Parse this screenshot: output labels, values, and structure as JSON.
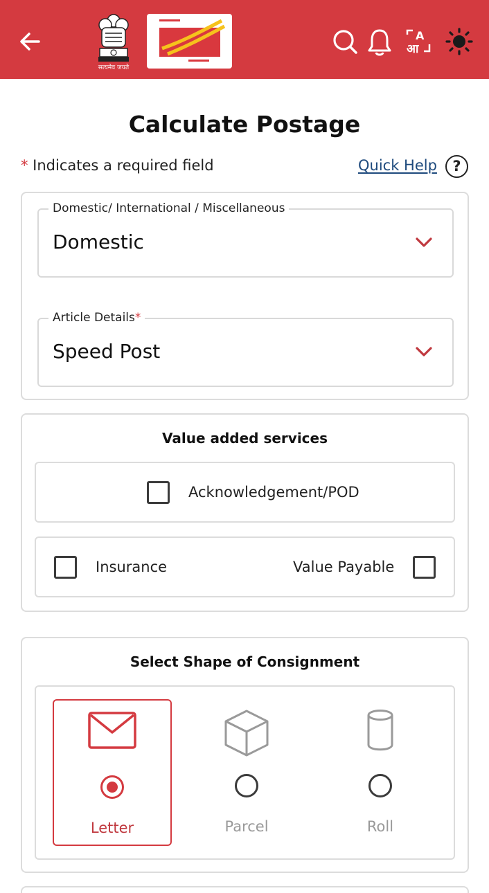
{
  "header": {
    "bg_color": "#d43a40",
    "emblem_motto": "सत्यमेव जयते",
    "icons": [
      "back-arrow-icon",
      "search-icon",
      "bell-icon",
      "translate-icon",
      "brightness-icon"
    ]
  },
  "page": {
    "title": "Calculate Postage",
    "required_note_star": "*",
    "required_note": " Indicates a required field",
    "quick_help": "Quick Help",
    "help_glyph": "?"
  },
  "form": {
    "category": {
      "label": "Domestic/ International / Miscellaneous",
      "value": "Domestic"
    },
    "article": {
      "label": "Article Details",
      "required_star": "*",
      "value": "Speed Post"
    }
  },
  "value_added_services": {
    "title": "Value added services",
    "options": [
      {
        "label": "Acknowledgement/POD",
        "checked": false
      },
      {
        "label": "Insurance",
        "checked": false
      },
      {
        "label": "Value Payable",
        "checked": false
      }
    ]
  },
  "shape": {
    "title": "Select Shape of Consignment",
    "options": [
      {
        "label": "Letter",
        "icon": "envelope-icon",
        "selected": true
      },
      {
        "label": "Parcel",
        "icon": "box-icon",
        "selected": false
      },
      {
        "label": "Roll",
        "icon": "cylinder-icon",
        "selected": false
      }
    ]
  },
  "colors": {
    "accent": "#d43a40",
    "link": "#1e4a7d",
    "muted": "#999999"
  }
}
